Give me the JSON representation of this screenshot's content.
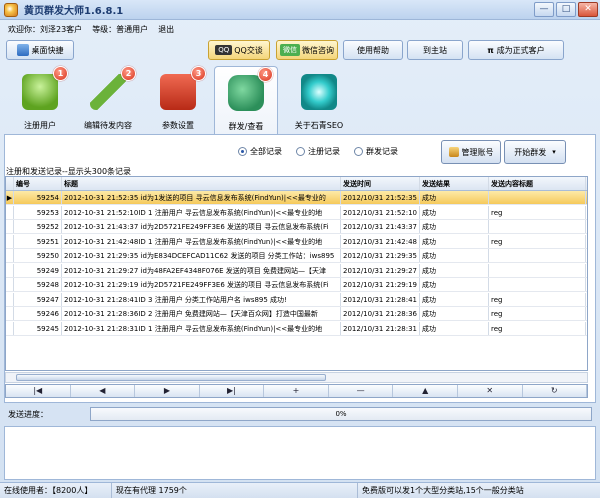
{
  "window": {
    "title": "黄页群发大师1.6.8.1",
    "min": "—",
    "max": "□",
    "close": "✕"
  },
  "user": {
    "welcome": "欢迎你：刘泽23客户",
    "level": "等级：普通用户",
    "logout": "退出"
  },
  "toolbar": {
    "desktop_shortcut": "桌面快捷",
    "qq_exchange": "QQ交谈",
    "qq_tag": "QQ",
    "wechat_consult": "微信咨询",
    "wechat_tag": "微信",
    "help": "使用帮助",
    "main_site": "到主站",
    "become_customer": "成为正式客户"
  },
  "tabs": [
    {
      "label": "注册用户",
      "badge": "1"
    },
    {
      "label": "编辑待发内容",
      "badge": "2"
    },
    {
      "label": "参数设置",
      "badge": "3"
    },
    {
      "label": "群发/查看",
      "badge": "4"
    },
    {
      "label": "关于石青SEO",
      "badge": ""
    }
  ],
  "filters": {
    "all": "全部记录",
    "register": "注册记录",
    "broadcast": "群发记录",
    "selected": "all"
  },
  "buttons": {
    "manage_accounts": "管理账号",
    "start_broadcast": "开始群发"
  },
  "records_caption": "注册和发送记录--显示头300条记录",
  "grid": {
    "columns": [
      "编号",
      "标题",
      "发送时间",
      "发送结果",
      "发送内容标题"
    ],
    "rows": [
      {
        "id": "59254",
        "title": "2012-10-31 21:52:35 id为1发送的项目 寻云信息发布系统(FindYun)|<<最专业的",
        "time": "2012/10/31 21:52:35",
        "result": "成功",
        "content": ""
      },
      {
        "id": "59253",
        "title": "2012-10-31 21:52:10ID 1 注册用户 寻云信息发布系统(FindYun)|<<最专业的地",
        "time": "2012/10/31 21:52:10",
        "result": "成功",
        "content": "reg"
      },
      {
        "id": "59252",
        "title": "2012-10-31 21:43:37 id为2D5721FE249FF3E6 发送的项目 寻云信息发布系统(Fi",
        "time": "2012/10/31 21:43:37",
        "result": "成功",
        "content": ""
      },
      {
        "id": "59251",
        "title": "2012-10-31 21:42:48ID 1 注册用户 寻云信息发布系统(FindYun)|<<最专业的地",
        "time": "2012/10/31 21:42:48",
        "result": "成功",
        "content": "reg"
      },
      {
        "id": "59250",
        "title": "2012-10-31 21:29:35 id为E834DCEFCAD11C62 发送的项目 分类工作站：iws895",
        "time": "2012/10/31 21:29:35",
        "result": "成功",
        "content": ""
      },
      {
        "id": "59249",
        "title": "2012-10-31 21:29:27 id为48FA2EF4348F076E 发送的项目 免费建网站—【天津",
        "time": "2012/10/31 21:29:27",
        "result": "成功",
        "content": ""
      },
      {
        "id": "59248",
        "title": "2012-10-31 21:29:19 id为2D5721FE249FF3E6 发送的项目 寻云信息发布系统(Fi",
        "time": "2012/10/31 21:29:19",
        "result": "成功",
        "content": ""
      },
      {
        "id": "59247",
        "title": "2012-10-31 21:28:41ID 3 注册用户 分类工作站用户名 iws895 成功!",
        "time": "2012/10/31 21:28:41",
        "result": "成功",
        "content": "reg"
      },
      {
        "id": "59246",
        "title": "2012-10-31 21:28:36ID 2 注册用户 免费建网站—【天津百众网】打造中国最新",
        "time": "2012/10/31 21:28:36",
        "result": "成功",
        "content": "reg"
      },
      {
        "id": "59245",
        "title": "2012-10-31 21:28:31ID 1 注册用户 寻云信息发布系统(FindYun)|<<最专业的地",
        "time": "2012/10/31 21:28:31",
        "result": "成功",
        "content": "reg"
      }
    ]
  },
  "navigator": [
    "|◀",
    "◀",
    "▶",
    "▶|",
    "+",
    "—",
    "▲",
    "✕",
    "↻"
  ],
  "progress": {
    "label": "发送进度：",
    "value": "0%",
    "fraction": 0
  },
  "statusbar": {
    "online": "在线使用者：【8200人】",
    "proxies": "现在有代理 1759个",
    "note": "免费版可以发1个大型分类站,15个一般分类站"
  },
  "colors": {
    "selected_row": "#f5c95b",
    "badge": "#d8321c",
    "chrome": "#d3e1f2"
  }
}
